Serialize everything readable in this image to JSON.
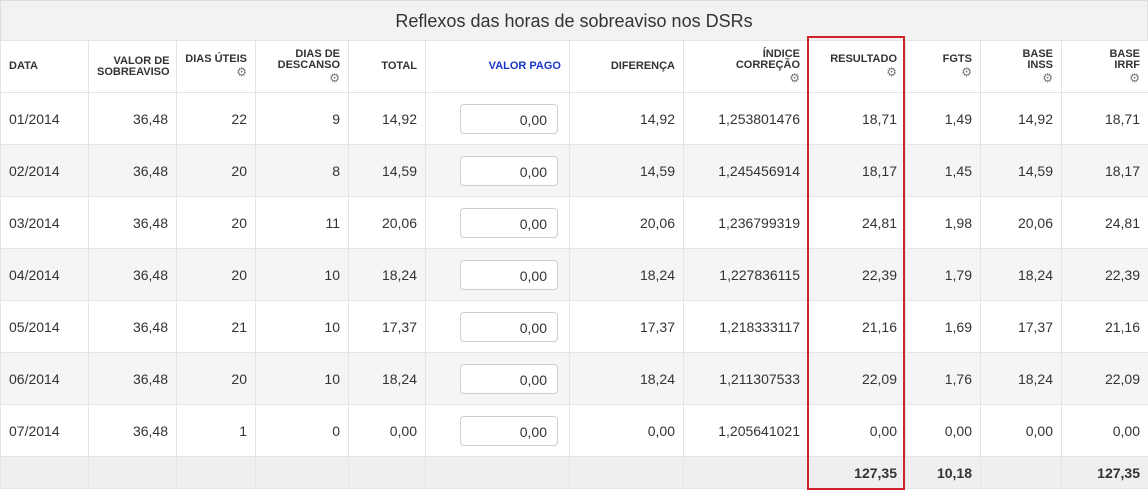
{
  "title": "Reflexos das horas de sobreaviso nos DSRs",
  "colors": {
    "highlight": "#d0222a",
    "header_link": "#1a35c7",
    "stripe": "#f5f5f5"
  },
  "columns": [
    {
      "key": "data",
      "l1": "DATA",
      "l2": "",
      "gear": false
    },
    {
      "key": "valor",
      "l1": "VALOR DE",
      "l2": "SOBREAVISO",
      "gear": false
    },
    {
      "key": "uteis",
      "l1": "DIAS ÚTEIS",
      "l2": "",
      "gear": true
    },
    {
      "key": "descanso",
      "l1": "DIAS DE",
      "l2": "DESCANSO",
      "gear": true
    },
    {
      "key": "total",
      "l1": "TOTAL",
      "l2": "",
      "gear": false
    },
    {
      "key": "valorpago",
      "l1": "VALOR PAGO",
      "l2": "",
      "gear": false
    },
    {
      "key": "diferenca",
      "l1": "DIFERENÇA",
      "l2": "",
      "gear": false
    },
    {
      "key": "indice",
      "l1": "ÍNDICE",
      "l2": "CORREÇÃO",
      "gear": true
    },
    {
      "key": "resultado",
      "l1": "RESULTADO",
      "l2": "",
      "gear": true
    },
    {
      "key": "fgts",
      "l1": "FGTS",
      "l2": "",
      "gear": true
    },
    {
      "key": "inss",
      "l1": "BASE",
      "l2": "INSS",
      "gear": true
    },
    {
      "key": "irrf",
      "l1": "BASE",
      "l2": "IRRF",
      "gear": true
    }
  ],
  "rows": [
    [
      "01/2014",
      "36,48",
      "22",
      "9",
      "14,92",
      "0,00",
      "14,92",
      "1,253801476",
      "18,71",
      "1,49",
      "14,92",
      "18,71"
    ],
    [
      "02/2014",
      "36,48",
      "20",
      "8",
      "14,59",
      "0,00",
      "14,59",
      "1,245456914",
      "18,17",
      "1,45",
      "14,59",
      "18,17"
    ],
    [
      "03/2014",
      "36,48",
      "20",
      "11",
      "20,06",
      "0,00",
      "20,06",
      "1,236799319",
      "24,81",
      "1,98",
      "20,06",
      "24,81"
    ],
    [
      "04/2014",
      "36,48",
      "20",
      "10",
      "18,24",
      "0,00",
      "18,24",
      "1,227836115",
      "22,39",
      "1,79",
      "18,24",
      "22,39"
    ],
    [
      "05/2014",
      "36,48",
      "21",
      "10",
      "17,37",
      "0,00",
      "17,37",
      "1,218333117",
      "21,16",
      "1,69",
      "17,37",
      "21,16"
    ],
    [
      "06/2014",
      "36,48",
      "20",
      "10",
      "18,24",
      "0,00",
      "18,24",
      "1,211307533",
      "22,09",
      "1,76",
      "18,24",
      "22,09"
    ],
    [
      "07/2014",
      "36,48",
      "1",
      "0",
      "0,00",
      "0,00",
      "0,00",
      "1,205641021",
      "0,00",
      "0,00",
      "0,00",
      "0,00"
    ]
  ],
  "totals": [
    "",
    "",
    "",
    "",
    "",
    "",
    "",
    "",
    "127,35",
    "10,18",
    "",
    "127,35"
  ]
}
